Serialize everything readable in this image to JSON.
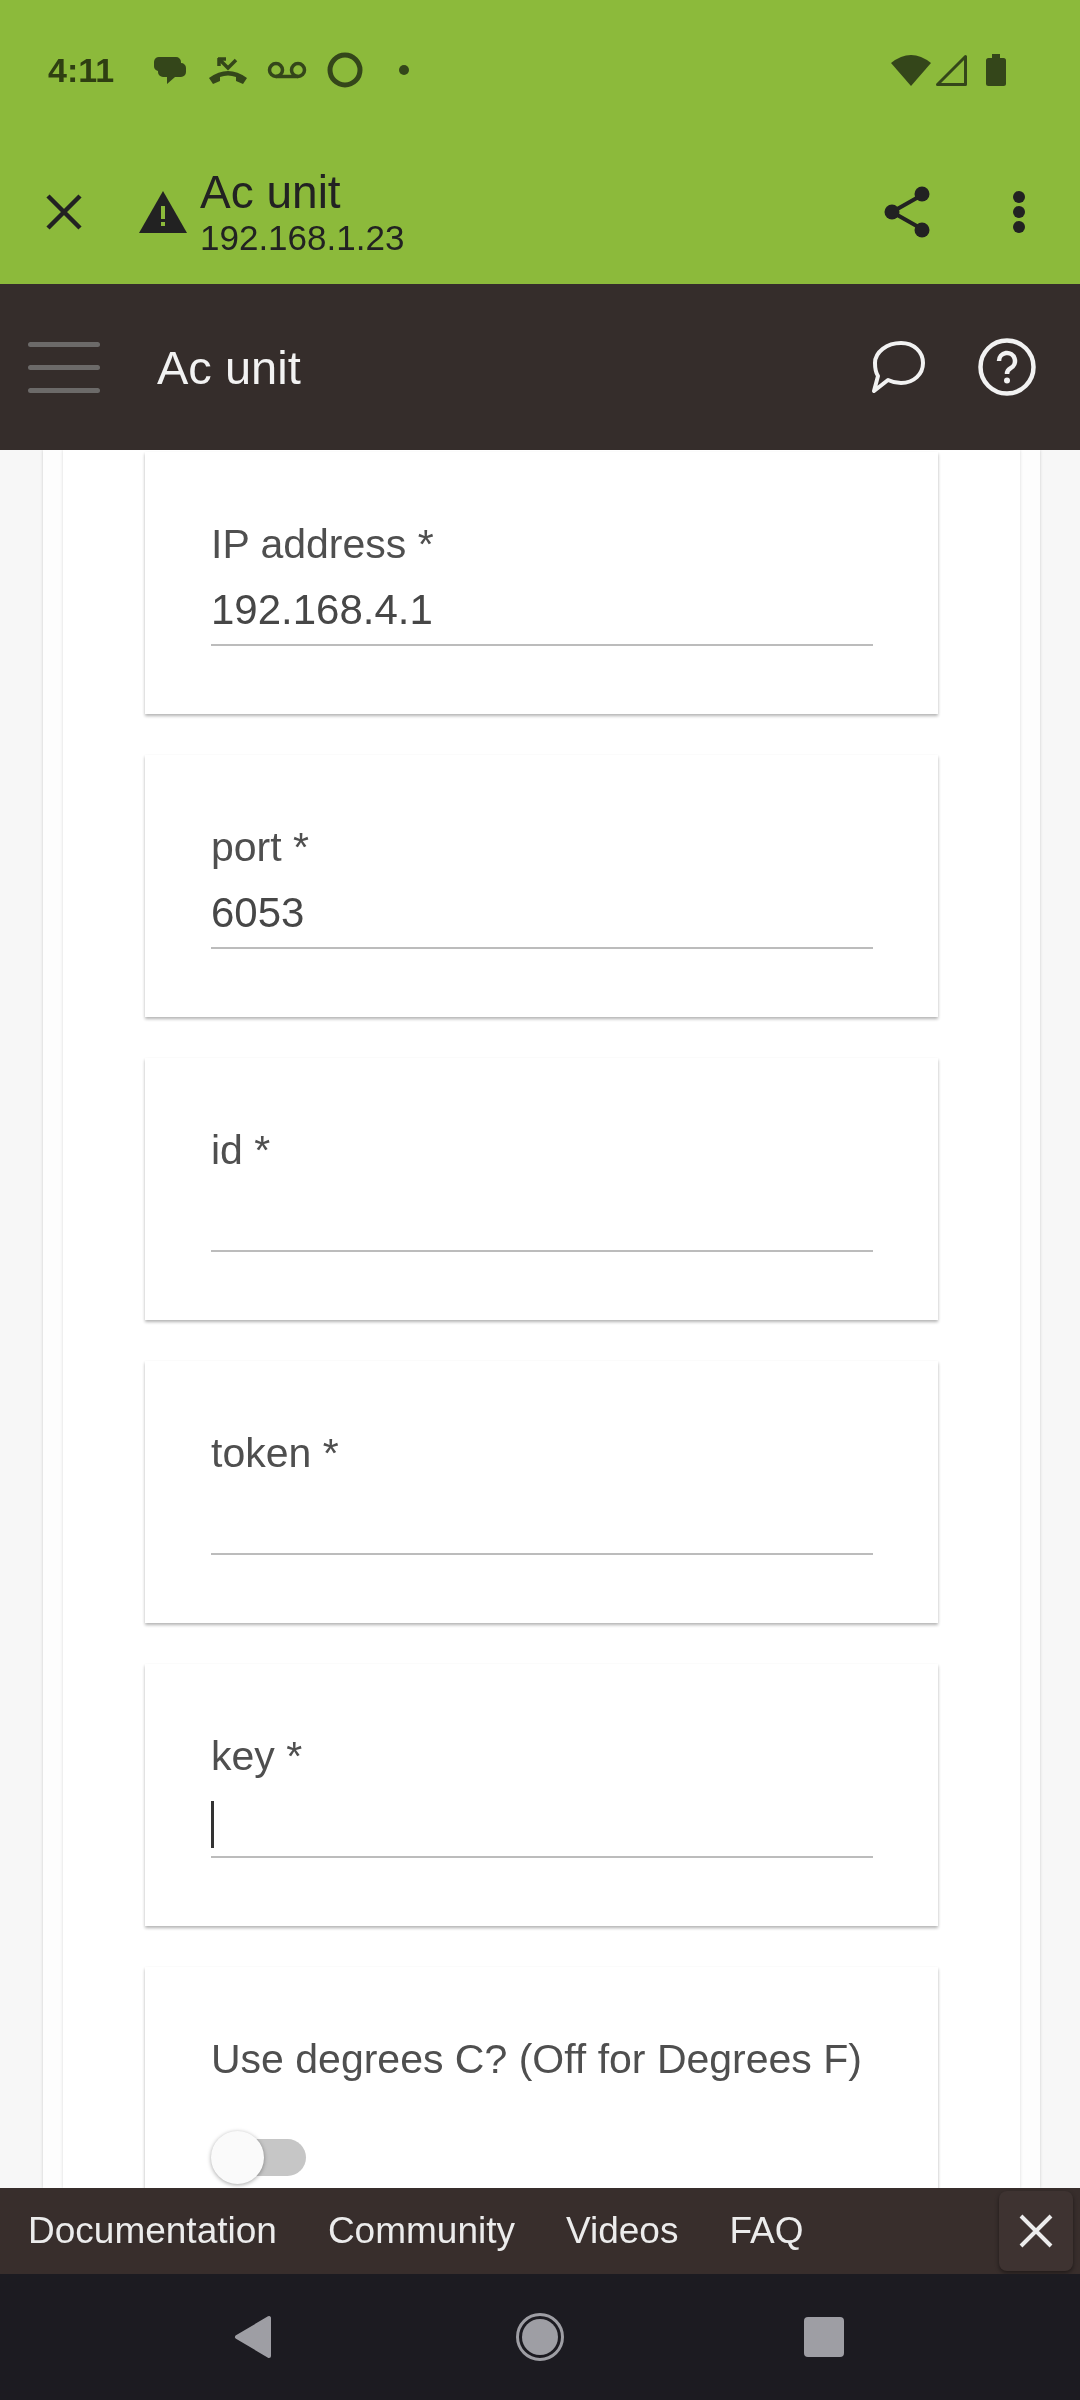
{
  "status_bar": {
    "time": "4:11"
  },
  "browser_bar": {
    "title": "Ac unit",
    "url": "192.168.1.23"
  },
  "app_bar": {
    "title": "Ac unit"
  },
  "form": {
    "fields": [
      {
        "kind": "text",
        "label": "IP address *",
        "value": "192.168.4.1",
        "focused": false
      },
      {
        "kind": "text",
        "label": "port *",
        "value": "6053",
        "focused": false
      },
      {
        "kind": "text",
        "label": "id *",
        "focused": false
      },
      {
        "kind": "text",
        "label": "token *",
        "focused": false
      },
      {
        "kind": "text",
        "label": "key *",
        "focused": true
      },
      {
        "kind": "toggle",
        "label": "Use degrees C? (Off for Degrees F)",
        "on": false
      }
    ]
  },
  "footer": {
    "links": [
      "Documentation",
      "Community",
      "Videos",
      "FAQ"
    ]
  }
}
